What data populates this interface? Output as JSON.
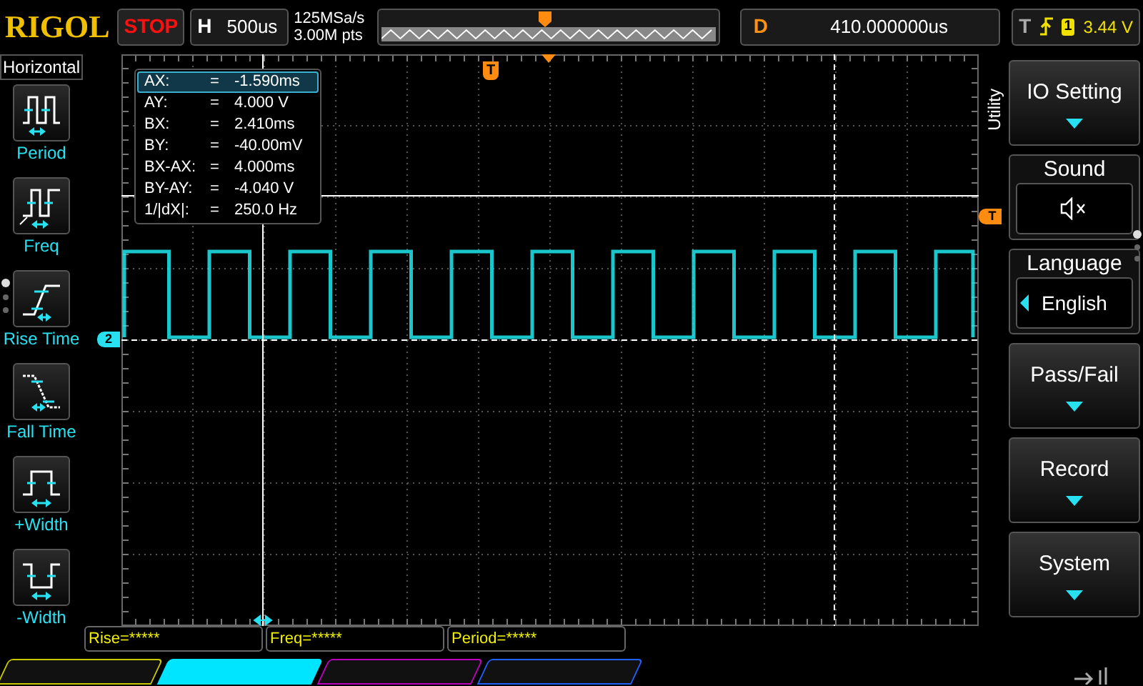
{
  "brand": "RIGOL",
  "run_state": {
    "label": "STOP",
    "kind": "stop"
  },
  "timebase": {
    "label": "H",
    "value": "500us"
  },
  "acquisition": {
    "sample_rate": "125MSa/s",
    "memory_depth": "3.00M pts"
  },
  "delay": {
    "label": "D",
    "value": "410.000000us"
  },
  "trigger": {
    "label": "T",
    "source": "1",
    "voltage": "3.44 V"
  },
  "left_menu": {
    "title": "Horizontal",
    "items": [
      {
        "label": "Period",
        "kind": "period"
      },
      {
        "label": "Freq",
        "kind": "freq"
      },
      {
        "label": "Rise Time",
        "kind": "rise"
      },
      {
        "label": "Fall Time",
        "kind": "fall"
      },
      {
        "label": "+Width",
        "kind": "pwidth"
      },
      {
        "label": "-Width",
        "kind": "nwidth"
      }
    ]
  },
  "cursor_readout": [
    {
      "name": "AX:",
      "eq": "=",
      "value": "-1.590ms",
      "selected": true
    },
    {
      "name": "AY:",
      "eq": "=",
      "value": "4.000 V",
      "selected": false
    },
    {
      "name": "BX:",
      "eq": "=",
      "value": "2.410ms",
      "selected": false
    },
    {
      "name": "BY:",
      "eq": "=",
      "value": "-40.00mV",
      "selected": false
    },
    {
      "name": "BX-AX:",
      "eq": "=",
      "value": "4.000ms",
      "selected": false
    },
    {
      "name": "BY-AY:",
      "eq": "=",
      "value": "-4.040 V",
      "selected": false
    },
    {
      "name": "1/|dX|:",
      "eq": "=",
      "value": "250.0 Hz",
      "selected": false
    }
  ],
  "markers": {
    "channel": "2",
    "trigger_top": "T",
    "trigger_side": "T"
  },
  "right_menu": {
    "tab": "Utility",
    "items": [
      {
        "kind": "submenu",
        "label": "IO Setting"
      },
      {
        "kind": "sound",
        "label": "Sound",
        "muted": true
      },
      {
        "kind": "choice",
        "label": "Language",
        "value": "English"
      },
      {
        "kind": "submenu",
        "label": "Pass/Fail"
      },
      {
        "kind": "submenu",
        "label": "Record"
      },
      {
        "kind": "submenu",
        "label": "System"
      }
    ]
  },
  "measurements": [
    "Rise=*****",
    "Freq=*****",
    "Period=*****"
  ],
  "channels": [
    {
      "color": "#c8c800",
      "selected": false
    },
    {
      "color": "#00e5ff",
      "selected": true
    },
    {
      "color": "#c000c0",
      "selected": false
    },
    {
      "color": "#2060ff",
      "selected": false
    }
  ]
}
